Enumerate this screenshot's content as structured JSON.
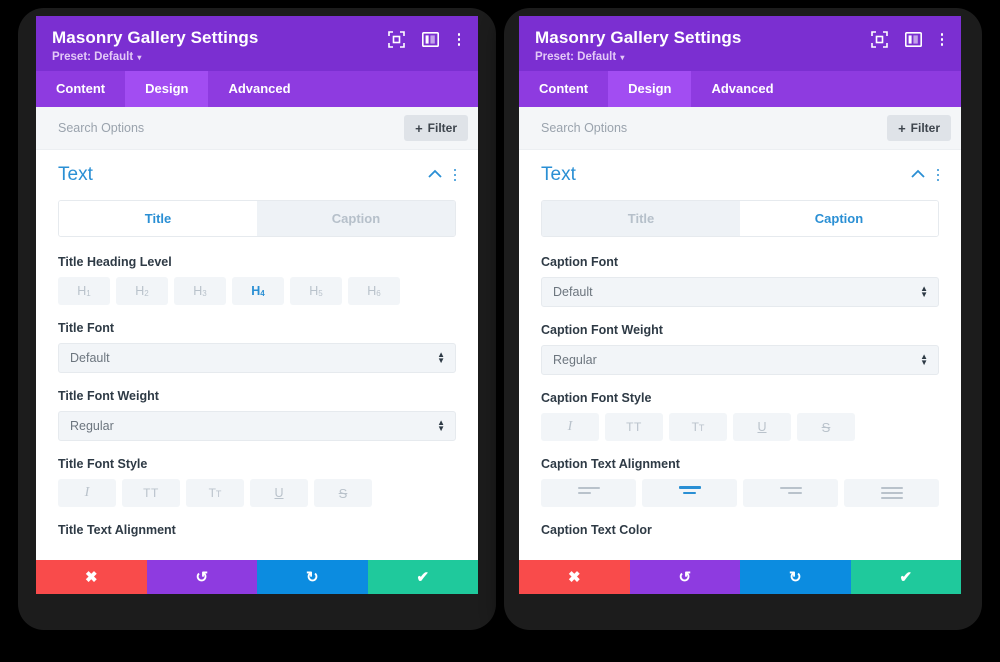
{
  "panels": [
    {
      "id": "left",
      "header": {
        "title": "Masonry Gallery Settings",
        "preset_label": "Preset: Default",
        "caret": "▾",
        "icons": [
          {
            "name": "focus-icon"
          },
          {
            "name": "layout-panel-icon"
          },
          {
            "name": "more-vertical-icon"
          }
        ]
      },
      "tabs": [
        {
          "label": "Content",
          "active": false
        },
        {
          "label": "Design",
          "active": true
        },
        {
          "label": "Advanced",
          "active": false
        }
      ],
      "search": {
        "placeholder": "Search Options",
        "value": ""
      },
      "filter": {
        "label": "Filter",
        "plus": "+"
      },
      "section": {
        "title": "Text",
        "collapse_icon": "chevron-up-icon",
        "more_icon": "more-vertical-icon"
      },
      "toggle": [
        {
          "label": "Title",
          "active": true
        },
        {
          "label": "Caption",
          "active": false
        }
      ],
      "fields": [
        {
          "type": "options",
          "label": "Title Heading Level",
          "size": "h",
          "options": [
            {
              "label": "H",
              "sub": "1",
              "active": false
            },
            {
              "label": "H",
              "sub": "2",
              "active": false
            },
            {
              "label": "H",
              "sub": "3",
              "active": false
            },
            {
              "label": "H",
              "sub": "4",
              "active": true
            },
            {
              "label": "H",
              "sub": "5",
              "active": false
            },
            {
              "label": "H",
              "sub": "6",
              "active": false
            }
          ]
        },
        {
          "type": "select",
          "label": "Title Font",
          "value": "Default"
        },
        {
          "type": "select",
          "label": "Title Font Weight",
          "value": "Regular"
        },
        {
          "type": "styleicons",
          "label": "Title Font Style",
          "options": [
            {
              "name": "italic-icon",
              "glyph": "I",
              "active": false
            },
            {
              "name": "uppercase-icon",
              "glyph": "TT",
              "active": false
            },
            {
              "name": "smallcaps-icon",
              "glyph": "T",
              "glyph_small": "T",
              "active": false
            },
            {
              "name": "underline-icon",
              "glyph": "U",
              "active": false
            },
            {
              "name": "strikethrough-icon",
              "glyph": "S",
              "active": false
            }
          ]
        },
        {
          "type": "cut",
          "label": "Title Text Alignment"
        }
      ],
      "actions": [
        {
          "name": "cancel-button",
          "glyph": "✖",
          "color": "#F94B4B"
        },
        {
          "name": "undo-button",
          "glyph": "↺",
          "color": "#8E3BE0"
        },
        {
          "name": "redo-button",
          "glyph": "↻",
          "color": "#0C8CE0"
        },
        {
          "name": "save-button",
          "glyph": "✔",
          "color": "#1FC99C"
        }
      ]
    },
    {
      "id": "right",
      "header": {
        "title": "Masonry Gallery Settings",
        "preset_label": "Preset: Default",
        "caret": "▾",
        "icons": [
          {
            "name": "focus-icon"
          },
          {
            "name": "layout-panel-icon"
          },
          {
            "name": "more-vertical-icon"
          }
        ]
      },
      "tabs": [
        {
          "label": "Content",
          "active": false
        },
        {
          "label": "Design",
          "active": true
        },
        {
          "label": "Advanced",
          "active": false
        }
      ],
      "search": {
        "placeholder": "Search Options",
        "value": ""
      },
      "filter": {
        "label": "Filter",
        "plus": "+"
      },
      "section": {
        "title": "Text",
        "collapse_icon": "chevron-up-icon",
        "more_icon": "more-vertical-icon"
      },
      "toggle": [
        {
          "label": "Title",
          "active": false
        },
        {
          "label": "Caption",
          "active": true
        }
      ],
      "fields": [
        {
          "type": "select",
          "label": "Caption Font",
          "value": "Default"
        },
        {
          "type": "select",
          "label": "Caption Font Weight",
          "value": "Regular"
        },
        {
          "type": "styleicons",
          "label": "Caption Font Style",
          "options": [
            {
              "name": "italic-icon",
              "glyph": "I",
              "active": false
            },
            {
              "name": "uppercase-icon",
              "glyph": "TT",
              "active": false
            },
            {
              "name": "smallcaps-icon",
              "glyph": "T",
              "glyph_small": "T",
              "active": false
            },
            {
              "name": "underline-icon",
              "glyph": "U",
              "active": false
            },
            {
              "name": "strikethrough-icon",
              "glyph": "S",
              "active": false
            }
          ]
        },
        {
          "type": "alignicons",
          "label": "Caption Text Alignment",
          "options": [
            {
              "name": "align-left-icon",
              "mode": "l",
              "active": false
            },
            {
              "name": "align-center-icon",
              "mode": "c",
              "active": true
            },
            {
              "name": "align-right-icon",
              "mode": "r",
              "active": false
            },
            {
              "name": "align-justify-icon",
              "mode": "j",
              "active": false
            }
          ]
        },
        {
          "type": "cut",
          "label": "Caption Text Color"
        }
      ],
      "actions": [
        {
          "name": "cancel-button",
          "glyph": "✖",
          "color": "#F94B4B"
        },
        {
          "name": "undo-button",
          "glyph": "↺",
          "color": "#8E3BE0"
        },
        {
          "name": "redo-button",
          "glyph": "↻",
          "color": "#0C8CE0"
        },
        {
          "name": "save-button",
          "glyph": "✔",
          "color": "#1FC99C"
        }
      ]
    }
  ],
  "colors": {
    "header_purple": "#7B2FD1",
    "tabbar_purple": "#8E3BE0",
    "tab_active_purple": "#A24DF2",
    "accent_blue": "#2A8FD4",
    "cancel_red": "#F94B4B",
    "undo_purple": "#8E3BE0",
    "redo_blue": "#0C8CE0",
    "save_green": "#1FC99C",
    "bezel": "#1C1C1C",
    "background": "#000000"
  }
}
